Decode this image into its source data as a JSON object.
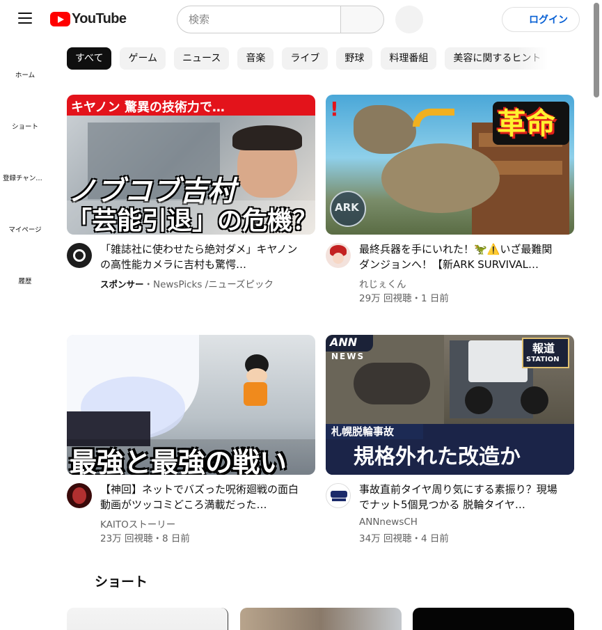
{
  "header": {
    "logo_text": "YouTube",
    "search_placeholder": "検索",
    "login_label": "ログイン"
  },
  "sidebar": {
    "items": [
      {
        "label": "ホーム",
        "icon": "home-icon"
      },
      {
        "label": "ショート",
        "icon": "shorts-icon"
      },
      {
        "label": "登録チャンネル",
        "icon": "subscriptions-icon"
      },
      {
        "label": "マイページ",
        "icon": "you-icon"
      },
      {
        "label": "履歴",
        "icon": "history-icon"
      }
    ]
  },
  "chips": [
    "すべて",
    "ゲーム",
    "ニュース",
    "音楽",
    "ライブ",
    "野球",
    "料理番組",
    "美容に関するヒント"
  ],
  "videos": [
    {
      "title": "「雑誌社に使わせたら絶対ダメ」キヤノンの高性能カメラに吉村も驚愕…",
      "sponsor_label": "スポンサー",
      "channel": "・NewsPicks /ニューズピック",
      "views": "",
      "thumb_text": {
        "banner": "キヤノン 驚異の技術力で…",
        "line1": "ノブコブ吉村",
        "line2": "「芸能引退」の危機？"
      }
    },
    {
      "title": "最終兵器を手にいれた！🦖⚠️いざ最難関ダンジョンへ！【新ARK SURVIVAL…",
      "channel": "れじぇくん",
      "views": "29万 回視聴・1 日前",
      "thumb_text": {
        "badge": "革命",
        "ark": "ARK"
      }
    },
    {
      "title": "【神回】ネットでバズった呪術廻戦の面白動画がツッコミどころ満載だった…",
      "channel": "KAITOストーリー",
      "views": "23万 回視聴・8 日前",
      "thumb_text": {
        "caption": "最強と最強の戦い"
      }
    },
    {
      "title": "事故直前タイヤ周り気にする素振り？現場でナット5個見つかる 脱輪タイヤ…",
      "channel": "ANNnewsCH",
      "views": "34万 回視聴・4 日前",
      "thumb_text": {
        "ann": "ANN",
        "news": "NEWS",
        "station1": "報道",
        "station2": "STATION",
        "sub": "札幌脱輪事故",
        "caption": "規格外れた改造か"
      }
    }
  ],
  "shorts": {
    "heading": "ショート"
  },
  "colors": {
    "brand_red": "#ff0000",
    "link_blue": "#065fd4",
    "chip_active": "#0f0f0f",
    "chip_bg": "#f2f2f2"
  }
}
